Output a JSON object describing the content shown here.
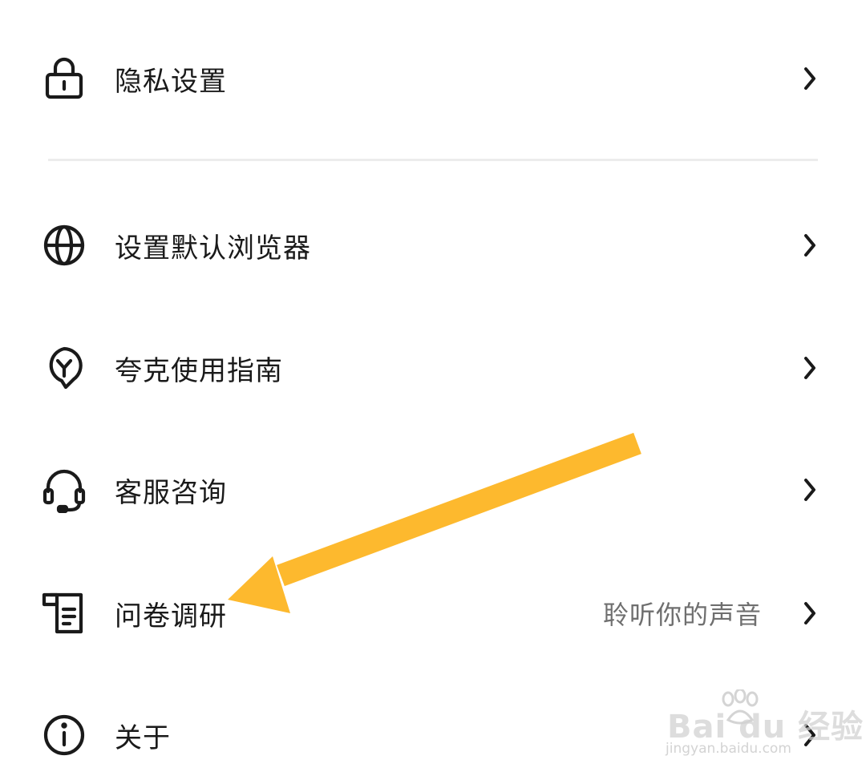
{
  "settings": {
    "items": [
      {
        "label": "隐私设置",
        "subtext": "",
        "icon": "lock-icon"
      },
      {
        "label": "设置默认浏览器",
        "subtext": "",
        "icon": "globe-icon"
      },
      {
        "label": "夸克使用指南",
        "subtext": "",
        "icon": "lightbulb-guide-icon"
      },
      {
        "label": "客服咨询",
        "subtext": "",
        "icon": "headset-icon"
      },
      {
        "label": "问卷调研",
        "subtext": "聆听你的声音",
        "icon": "survey-icon"
      },
      {
        "label": "关于",
        "subtext": "",
        "icon": "info-icon"
      }
    ]
  },
  "annotation": {
    "arrow_color": "#FDB92E"
  },
  "watermark": {
    "brand": "Bai du 经验",
    "url": "jingyan.baidu.com"
  },
  "colors": {
    "text": "#1a1a1a",
    "subtext": "#6f6f6f",
    "divider": "#ececec"
  }
}
